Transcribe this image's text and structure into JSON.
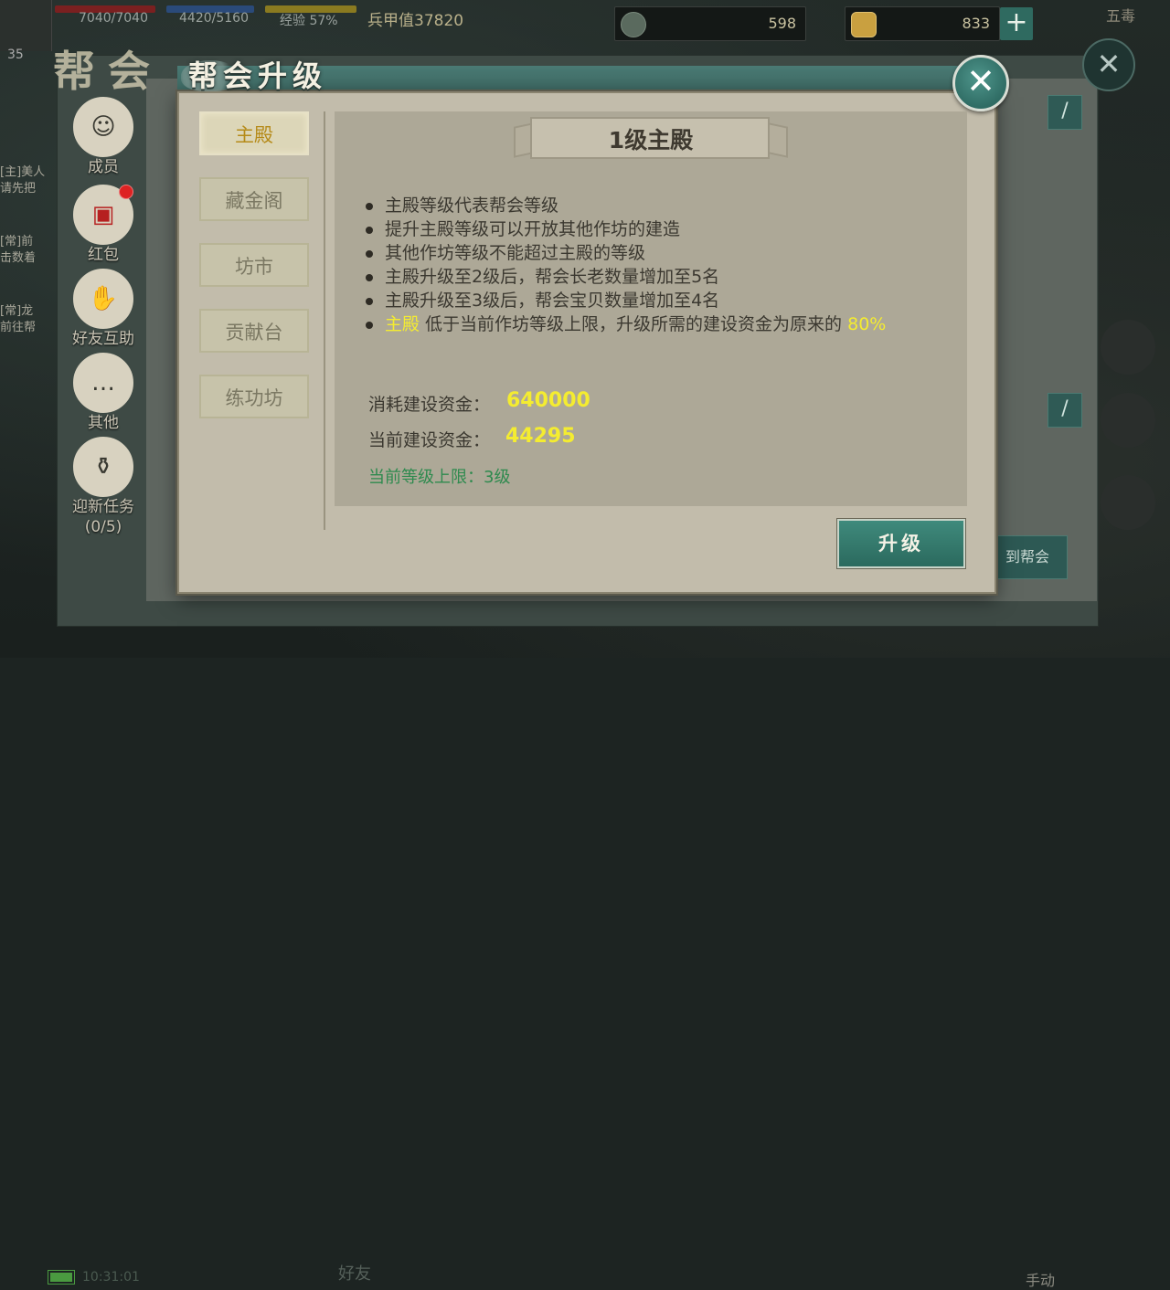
{
  "hud": {
    "hp": "7040/7040",
    "mp": "4420/5160",
    "exp": "经验 57%",
    "level": "35",
    "power": "兵甲值37820",
    "resource1": "598",
    "resource2": "833",
    "topright": "五毒"
  },
  "guild": {
    "title": "帮会",
    "goto_guild": "到帮会"
  },
  "left_menu": [
    {
      "label": "成员",
      "icon": "members-icon"
    },
    {
      "label": "红包",
      "icon": "red-packet-icon"
    },
    {
      "label": "好友互助",
      "icon": "handshake-icon"
    },
    {
      "label": "其他",
      "icon": "scroll-icon"
    },
    {
      "label": "迎新任务",
      "sub": "(0/5)",
      "icon": "welcome-task-icon"
    }
  ],
  "chat": [
    "[主]美人",
    "请先把",
    "[常]前",
    "击数着",
    "[常]龙",
    "前往帮"
  ],
  "bottom": {
    "clock": "10:31:01",
    "friend": "好友",
    "manual": "手动"
  },
  "dialog": {
    "title": "帮会升级",
    "close": "✕",
    "tabs": [
      "主殿",
      "藏金阁",
      "坊市",
      "贡献台",
      "练功坊"
    ],
    "active_tab": 0,
    "level_title": "1级主殿",
    "bullets": [
      "主殿等级代表帮会等级",
      "提升主殿等级可以开放其他作坊的建造",
      "其他作坊等级不能超过主殿的等级",
      "主殿升级至2级后，帮会长老数量增加至5名",
      "主殿升级至3级后，帮会宝贝数量增加至4名"
    ],
    "last_bullet": {
      "hl1": "主殿",
      "mid": " 低于当前作坊等级上限，升级所需的建设资金为原来的 ",
      "hl2": "80%"
    },
    "cost_label": "消耗建设资金：",
    "cost_value": "640000",
    "current_label": "当前建设资金：",
    "current_value": "44295",
    "level_cap": "当前等级上限：3级",
    "upgrade_button": "升级"
  },
  "colors": {
    "highlight": "#f4ec30",
    "accent_teal": "#2f6c64",
    "cap_green": "#2e8a4e"
  }
}
